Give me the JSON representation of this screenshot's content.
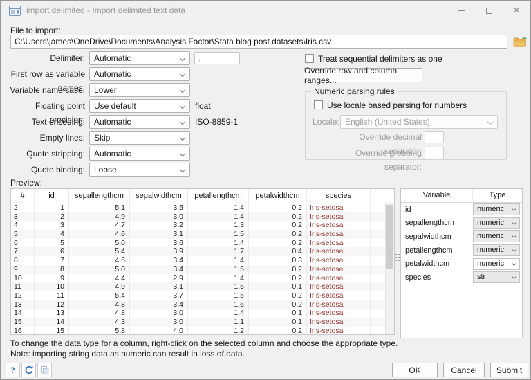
{
  "window": {
    "title": "import delimited - Import delimited text data",
    "controls": {
      "close": "✕"
    }
  },
  "file": {
    "label": "File to import:",
    "path": "C:\\Users\\james\\OneDrive\\Documents\\Analysis Factor\\Stata blog post datasets\\Iris.csv"
  },
  "options": {
    "delimiter": {
      "label": "Delimiter:",
      "value": "Automatic",
      "custom_value": ","
    },
    "first_row": {
      "label": "First row as variable names:",
      "value": "Automatic"
    },
    "name_case": {
      "label": "Variable name case:",
      "value": "Lower"
    },
    "precision": {
      "label": "Floating point precision:",
      "value": "Use default",
      "suffix": "float"
    },
    "encoding": {
      "label": "Text encoding:",
      "value": "Automatic",
      "suffix": "ISO-8859-1"
    },
    "empty_lines": {
      "label": "Empty lines:",
      "value": "Skip"
    },
    "quote_stripping": {
      "label": "Quote stripping:",
      "value": "Automatic"
    },
    "quote_binding": {
      "label": "Quote binding:",
      "value": "Loose"
    }
  },
  "right_panel": {
    "sequential_checkbox": "Treat sequential delimiters as one",
    "override_button": "Override row and column ranges...",
    "numeric_group": {
      "title": "Numeric parsing rules",
      "locale_checkbox": "Use locale based parsing for numbers",
      "locale_label": "Locale:",
      "locale_value": "English (United States)",
      "decimal_label": "Override decimal separator:",
      "grouping_label": "Override grouping separator:"
    }
  },
  "preview": {
    "label": "Preview:",
    "columns": [
      "#",
      "id",
      "sepallengthcm",
      "sepalwidthcm",
      "petallengthcm",
      "petalwidthcm",
      "species"
    ],
    "rows": [
      [
        "2",
        "1",
        "5.1",
        "3.5",
        "1.4",
        "0.2",
        "Iris-setosa"
      ],
      [
        "3",
        "2",
        "4.9",
        "3.0",
        "1.4",
        "0.2",
        "Iris-setosa"
      ],
      [
        "4",
        "3",
        "4.7",
        "3.2",
        "1.3",
        "0.2",
        "Iris-setosa"
      ],
      [
        "5",
        "4",
        "4.6",
        "3.1",
        "1.5",
        "0.2",
        "Iris-setosa"
      ],
      [
        "6",
        "5",
        "5.0",
        "3.6",
        "1.4",
        "0.2",
        "Iris-setosa"
      ],
      [
        "7",
        "6",
        "5.4",
        "3.9",
        "1.7",
        "0.4",
        "Iris-setosa"
      ],
      [
        "8",
        "7",
        "4.6",
        "3.4",
        "1.4",
        "0.3",
        "Iris-setosa"
      ],
      [
        "9",
        "8",
        "5.0",
        "3.4",
        "1.5",
        "0.2",
        "Iris-setosa"
      ],
      [
        "10",
        "9",
        "4.4",
        "2.9",
        "1.4",
        "0.2",
        "Iris-setosa"
      ],
      [
        "11",
        "10",
        "4.9",
        "3.1",
        "1.5",
        "0.1",
        "Iris-setosa"
      ],
      [
        "12",
        "11",
        "5.4",
        "3.7",
        "1.5",
        "0.2",
        "Iris-setosa"
      ],
      [
        "13",
        "12",
        "4.8",
        "3.4",
        "1.6",
        "0.2",
        "Iris-setosa"
      ],
      [
        "14",
        "13",
        "4.8",
        "3.0",
        "1.4",
        "0.1",
        "Iris-setosa"
      ],
      [
        "15",
        "14",
        "4.3",
        "3.0",
        "1.1",
        "0.1",
        "Iris-setosa"
      ],
      [
        "16",
        "15",
        "5.8",
        "4.0",
        "1.2",
        "0.2",
        "Iris-setosa"
      ]
    ]
  },
  "types": {
    "columns": [
      "Variable",
      "Type"
    ],
    "rows": [
      {
        "variable": "id",
        "type": "numeric",
        "active": false
      },
      {
        "variable": "sepallengthcm",
        "type": "numeric",
        "active": false
      },
      {
        "variable": "sepalwidthcm",
        "type": "numeric",
        "active": false
      },
      {
        "variable": "petallengthcm",
        "type": "numeric",
        "active": false
      },
      {
        "variable": "petalwidthcm",
        "type": "numeric",
        "active": true
      },
      {
        "variable": "species",
        "type": "str",
        "active": false
      }
    ]
  },
  "footer": {
    "hint1": "To change the data type for a column, right-click on the selected column and choose the appropriate type.",
    "hint2": "Note: importing string data as numeric can result in loss of data.",
    "help_label": "?",
    "ok": "OK",
    "cancel": "Cancel",
    "submit": "Submit"
  },
  "icons": {
    "titlebar": "form-dialog-icon",
    "browse": "folder-icon",
    "help": "question-mark-icon",
    "refresh": "refresh-icon",
    "copy": "copy-icon"
  },
  "colors": {
    "species_text": "#9c3732",
    "folder_yellow": "#e8b04b",
    "accent_blue": "#2e74c9",
    "background": "#f0f0f0"
  }
}
